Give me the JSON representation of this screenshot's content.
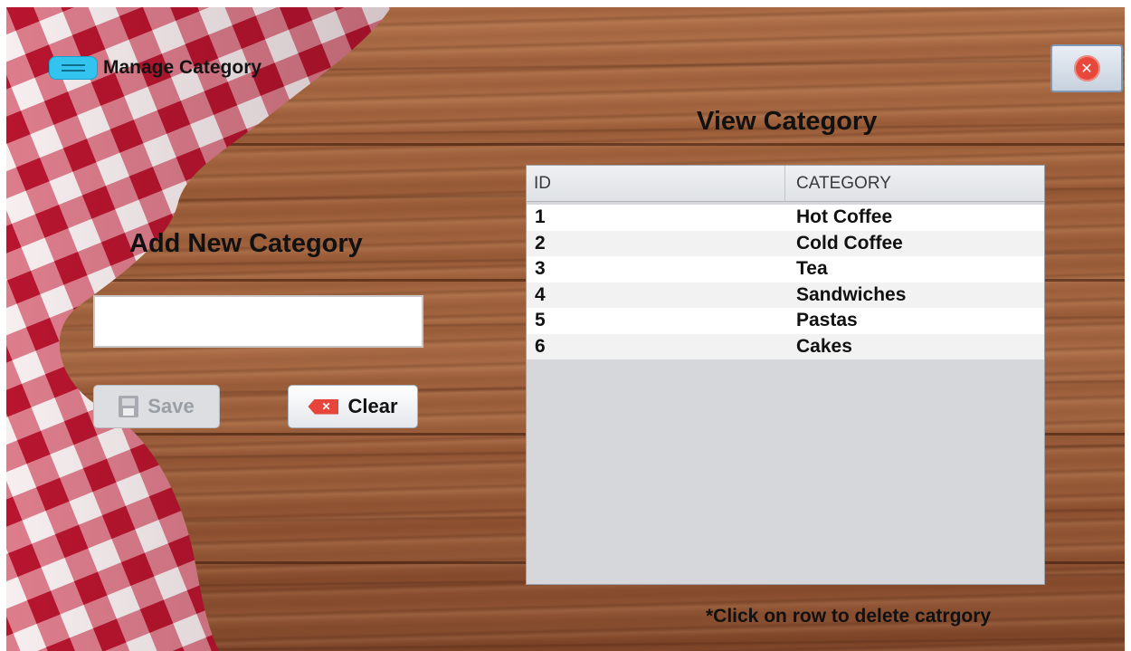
{
  "window": {
    "title": "Manage Category",
    "menu_icon": "hamburger-menu-icon",
    "close_icon": "close-icon"
  },
  "add_section": {
    "heading": "Add New Category",
    "input_value": "",
    "input_placeholder": "",
    "save_label": "Save",
    "save_icon": "floppy-disk-icon",
    "save_enabled": false,
    "clear_label": "Clear",
    "clear_icon": "clear-icon"
  },
  "view_section": {
    "heading": "View Category",
    "columns": [
      "ID",
      "CATEGORY"
    ],
    "rows": [
      {
        "id": "1",
        "category": "Hot Coffee"
      },
      {
        "id": "2",
        "category": "Cold Coffee"
      },
      {
        "id": "3",
        "category": "Tea"
      },
      {
        "id": "4",
        "category": "Sandwiches"
      },
      {
        "id": "5",
        "category": "Pastas"
      },
      {
        "id": "6",
        "category": "Cakes"
      }
    ],
    "note": "*Click on row to delete catrgory"
  },
  "colors": {
    "accent_blue": "#32c3ee",
    "close_red": "#e8473c",
    "wood": "#9a5c38",
    "checker_red": "#c8203a"
  }
}
